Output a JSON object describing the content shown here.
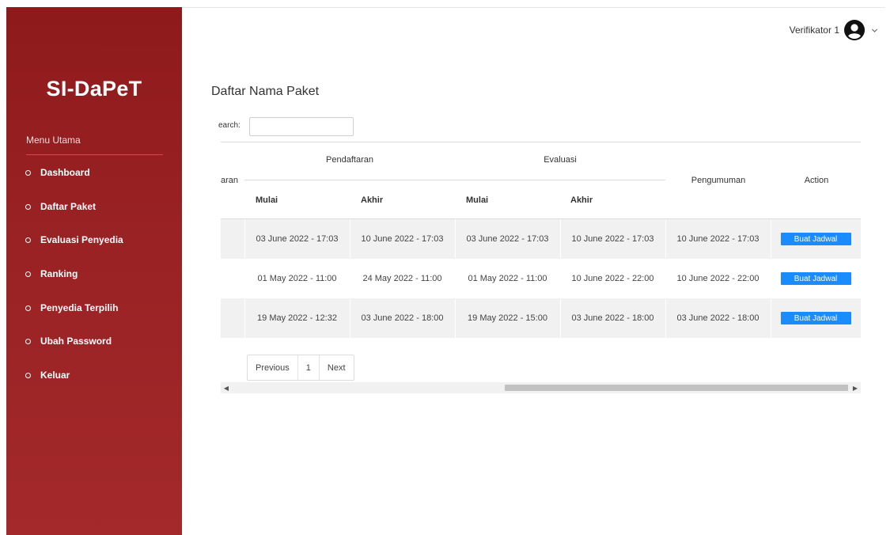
{
  "sidebar": {
    "brand": "SI-DaPeT",
    "heading": "Menu Utama",
    "items": [
      {
        "label": "Dashboard"
      },
      {
        "label": "Daftar Paket"
      },
      {
        "label": "Evaluasi Penyedia"
      },
      {
        "label": "Ranking"
      },
      {
        "label": "Penyedia Terpilih"
      },
      {
        "label": "Ubah Password"
      },
      {
        "label": "Keluar"
      }
    ]
  },
  "header": {
    "user_name": "Verifikator 1",
    "avatar_icon": "user-circle-icon"
  },
  "main": {
    "title": "Daftar Nama Paket",
    "search_label": "earch:",
    "search_value": ""
  },
  "table": {
    "cut_header": "aran",
    "group_headers": {
      "pendaftaran": "Pendaftaran",
      "evaluasi": "Evaluasi"
    },
    "headers": {
      "pendaftaran_mulai": "Mulai",
      "pendaftaran_akhir": "Akhir",
      "evaluasi_mulai": "Mulai",
      "evaluasi_akhir": "Akhir",
      "pengumuman": "Pengumuman",
      "action": "Action"
    },
    "rows": [
      {
        "pendaftaran_mulai": "03 June 2022 - 17:03",
        "pendaftaran_akhir": "10 June 2022 - 17:03",
        "evaluasi_mulai": "03 June 2022 - 17:03",
        "evaluasi_akhir": "10 June 2022 - 17:03",
        "pengumuman": "10 June 2022 - 17:03",
        "action": "Buat Jadwal"
      },
      {
        "pendaftaran_mulai": "01 May 2022 - 11:00",
        "pendaftaran_akhir": "24 May 2022 - 11:00",
        "evaluasi_mulai": "01 May 2022 - 11:00",
        "evaluasi_akhir": "10 June 2022 - 22:00",
        "pengumuman": "10 June 2022 - 22:00",
        "action": "Buat Jadwal"
      },
      {
        "pendaftaran_mulai": "19 May 2022 - 12:32",
        "pendaftaran_akhir": "03 June 2022 - 18:00",
        "evaluasi_mulai": "19 May 2022 - 15:00",
        "evaluasi_akhir": "03 June 2022 - 18:00",
        "pengumuman": "03 June 2022 - 18:00",
        "action": "Buat Jadwal"
      }
    ]
  },
  "pagination": {
    "previous": "Previous",
    "current": "1",
    "next": "Next"
  },
  "colors": {
    "sidebar_bg": "#9a2224",
    "button": "#1a8cff"
  }
}
